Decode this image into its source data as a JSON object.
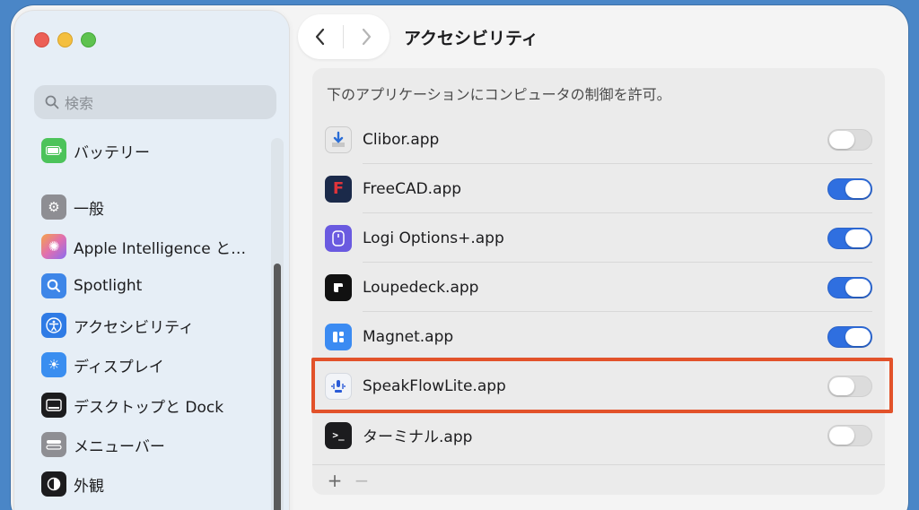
{
  "sidebar": {
    "search_placeholder": "検索",
    "items": [
      {
        "label": "バッテリー",
        "icon": "battery-icon",
        "color": "#4cc35a"
      },
      {
        "label": "一般",
        "icon": "gear-icon",
        "color": "#8e8e93"
      },
      {
        "label": "Apple Intelligence と…",
        "icon": "apple-intelligence-icon",
        "color": "#e06fb0"
      },
      {
        "label": "Spotlight",
        "icon": "spotlight-search-icon",
        "color": "#3e86e8"
      },
      {
        "label": "アクセシビリティ",
        "icon": "accessibility-icon",
        "color": "#2f7be5"
      },
      {
        "label": "ディスプレイ",
        "icon": "display-brightness-icon",
        "color": "#3a8ef0"
      },
      {
        "label": "デスクトップと Dock",
        "icon": "dock-icon",
        "color": "#1c1c1e"
      },
      {
        "label": "メニューバー",
        "icon": "menubar-icon",
        "color": "#8e8e93"
      },
      {
        "label": "外観",
        "icon": "appearance-icon",
        "color": "#1c1c1e"
      }
    ]
  },
  "header": {
    "title": "アクセシビリティ"
  },
  "panel": {
    "description": "下のアプリケーションにコンピュータの制御を許可。",
    "apps": [
      {
        "name": "Clibor.app",
        "enabled": false,
        "icon": "clibor-icon"
      },
      {
        "name": "FreeCAD.app",
        "enabled": true,
        "icon": "freecad-icon"
      },
      {
        "name": "Logi Options+.app",
        "enabled": true,
        "icon": "logi-options-icon"
      },
      {
        "name": "Loupedeck.app",
        "enabled": true,
        "icon": "loupedeck-icon"
      },
      {
        "name": "Magnet.app",
        "enabled": true,
        "icon": "magnet-icon"
      },
      {
        "name": "SpeakFlowLite.app",
        "enabled": false,
        "icon": "speakflowlite-icon"
      },
      {
        "name": "ターミナル.app",
        "enabled": false,
        "icon": "terminal-icon"
      }
    ],
    "add_label": "+",
    "remove_label": "−"
  },
  "colors": {
    "accent": "#2f6fe0",
    "highlight": "#e2522a"
  }
}
